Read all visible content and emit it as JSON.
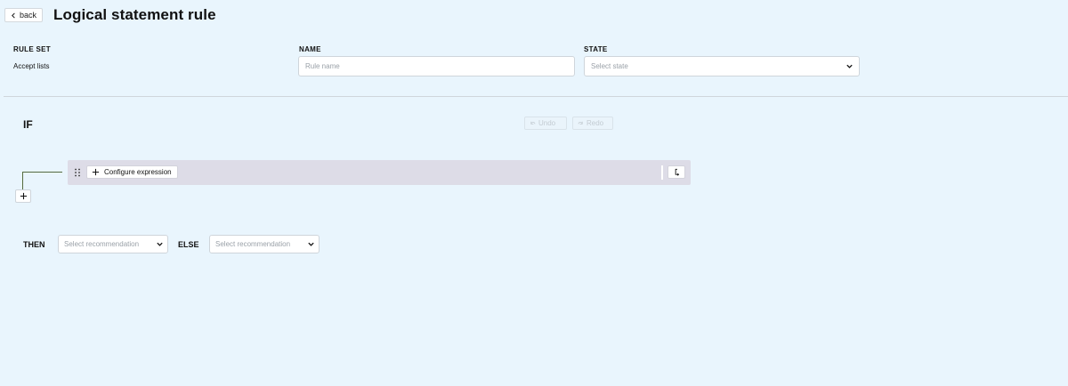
{
  "header": {
    "back_label": "back",
    "title": "Logical statement rule"
  },
  "form": {
    "rule_set": {
      "label": "RULE SET",
      "value": "Accept lists"
    },
    "name": {
      "label": "NAME",
      "value": "",
      "placeholder": "Rule name"
    },
    "state": {
      "label": "STATE",
      "placeholder": "Select state"
    }
  },
  "if_section": {
    "label": "IF",
    "undo_label": "Undo",
    "redo_label": "Redo",
    "configure_label": "Configure expression"
  },
  "outcomes": {
    "then_label": "THEN",
    "then_placeholder": "Select recommendation",
    "else_label": "ELSE",
    "else_placeholder": "Select recommendation"
  },
  "colors": {
    "background": "#e9f5fd",
    "expression_row": "#dddce7",
    "connector": "#556b3f"
  },
  "icons": [
    "chevron-left-icon",
    "chevron-down-icon",
    "undo-icon",
    "redo-icon",
    "drag-handle-icon",
    "plus-icon",
    "branch-icon"
  ]
}
